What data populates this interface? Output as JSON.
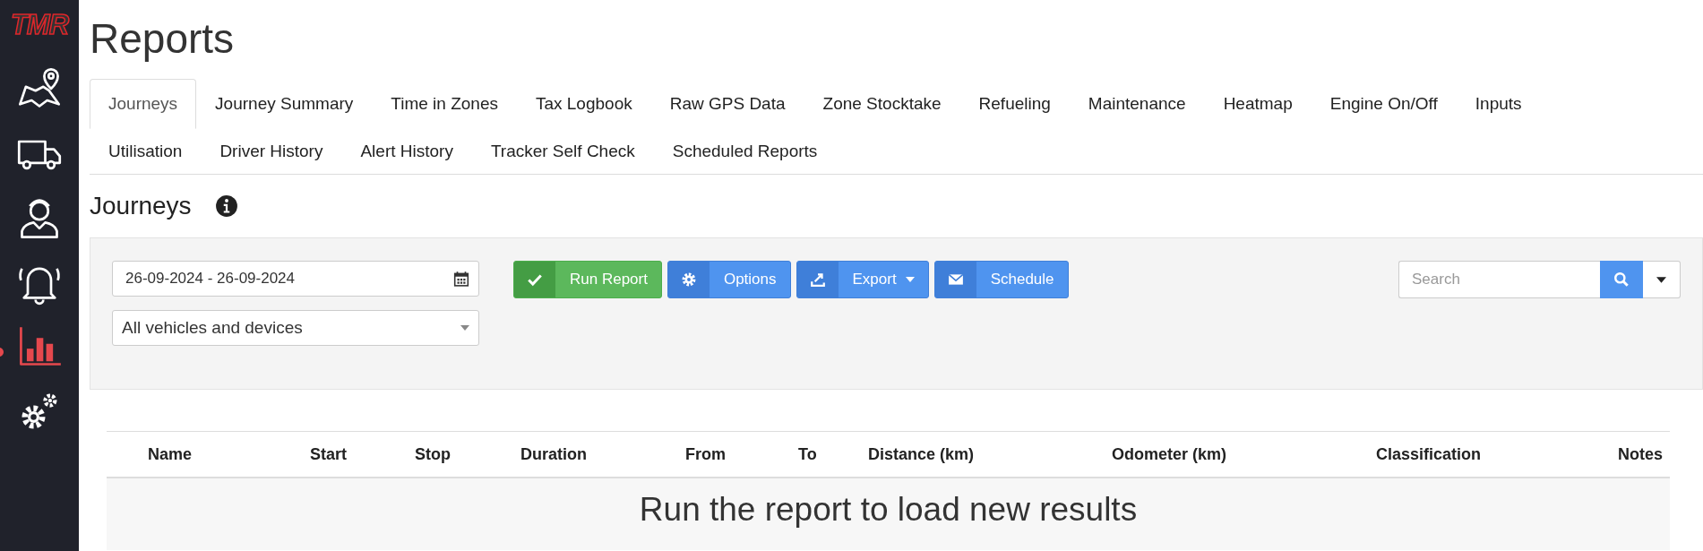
{
  "sidebar": {
    "logo": "TMR",
    "items": [
      {
        "kind": "map",
        "selected": false
      },
      {
        "kind": "truck",
        "selected": false
      },
      {
        "kind": "person",
        "selected": false
      },
      {
        "kind": "bell",
        "selected": false
      },
      {
        "kind": "chart",
        "selected": true
      },
      {
        "kind": "gears",
        "selected": false
      }
    ]
  },
  "page_title": "Reports",
  "tab_rows": [
    [
      {
        "label": "Journeys",
        "selected": true
      },
      {
        "label": "Journey Summary",
        "selected": false
      },
      {
        "label": "Time in Zones",
        "selected": false
      },
      {
        "label": "Tax Logbook",
        "selected": false
      },
      {
        "label": "Raw GPS Data",
        "selected": false
      },
      {
        "label": "Zone Stocktake",
        "selected": false
      },
      {
        "label": "Refueling",
        "selected": false
      },
      {
        "label": "Maintenance",
        "selected": false
      },
      {
        "label": "Heatmap",
        "selected": false
      },
      {
        "label": "Engine On/Off",
        "selected": false
      },
      {
        "label": "Inputs",
        "selected": false
      }
    ],
    [
      {
        "label": "Utilisation",
        "selected": false
      },
      {
        "label": "Driver History",
        "selected": false
      },
      {
        "label": "Alert History",
        "selected": false
      },
      {
        "label": "Tracker Self Check",
        "selected": false
      },
      {
        "label": "Scheduled Reports",
        "selected": false
      }
    ]
  ],
  "section_title": "Journeys",
  "filters": {
    "date_range": "26-09-2024 - 26-09-2024",
    "vehicles": "All vehicles and devices"
  },
  "buttons": [
    {
      "kind": "run",
      "label": "Run Report"
    },
    {
      "kind": "options",
      "label": "Options"
    },
    {
      "kind": "export",
      "label": "Export"
    },
    {
      "kind": "schedule",
      "label": "Schedule"
    }
  ],
  "search": {
    "placeholder": "Search"
  },
  "table": {
    "columns": [
      "Name",
      "Start",
      "Stop",
      "Duration",
      "From",
      "To",
      "Distance (km)",
      "Odometer (km)",
      "Classification",
      "Notes"
    ],
    "empty_message": "Run the report to load new results"
  }
}
